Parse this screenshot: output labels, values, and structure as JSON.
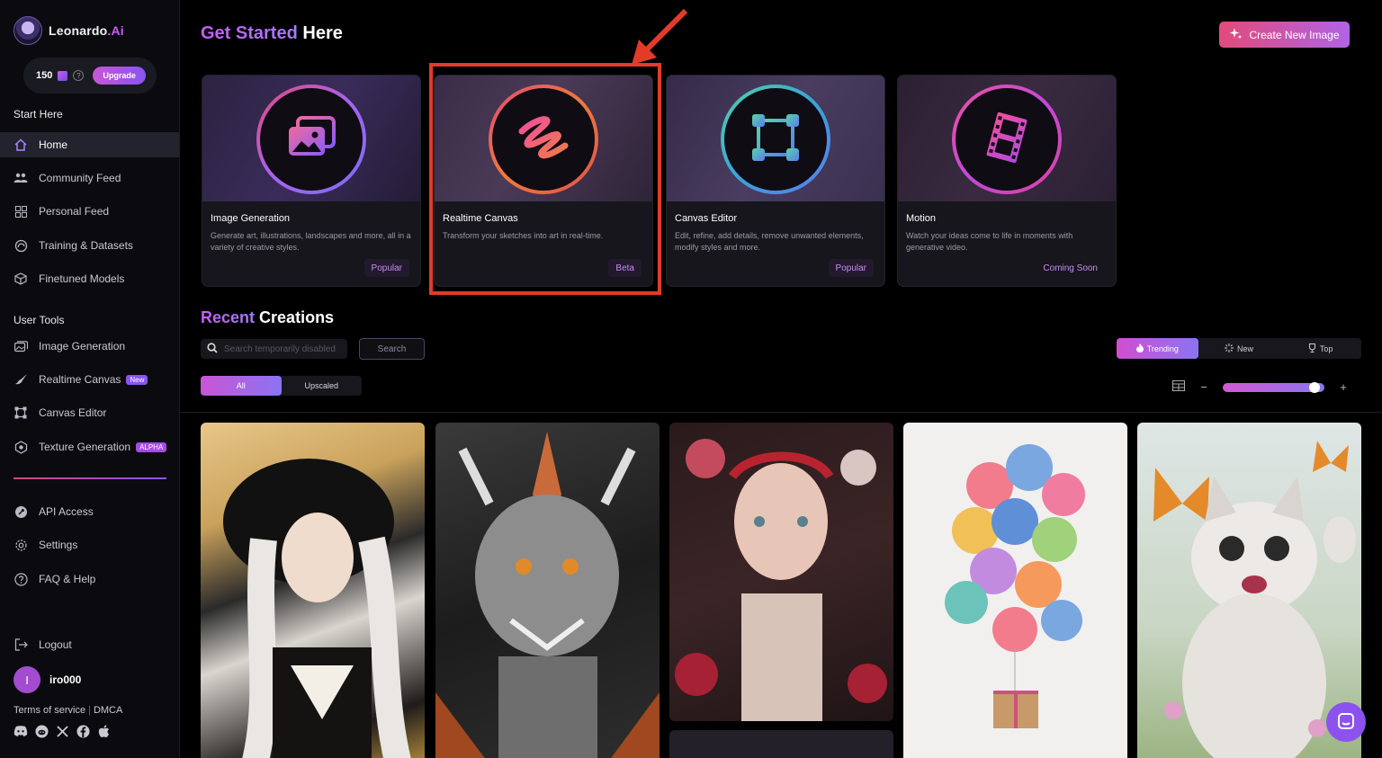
{
  "brand": {
    "name": "Leonardo",
    "suffix": ".Ai"
  },
  "credits": {
    "amount": "150",
    "upgrade_label": "Upgrade"
  },
  "sidebar": {
    "section_start": "Start Here",
    "start_items": [
      {
        "label": "Home",
        "icon": "home-icon"
      },
      {
        "label": "Community Feed",
        "icon": "users-icon"
      },
      {
        "label": "Personal Feed",
        "icon": "grid-icon"
      },
      {
        "label": "Training & Datasets",
        "icon": "training-icon"
      },
      {
        "label": "Finetuned Models",
        "icon": "cube-icon"
      }
    ],
    "section_tools": "User Tools",
    "tool_items": [
      {
        "label": "Image Generation",
        "icon": "image-icon"
      },
      {
        "label": "Realtime Canvas",
        "icon": "brush-icon",
        "badge": "New"
      },
      {
        "label": "Canvas Editor",
        "icon": "canvas-icon"
      },
      {
        "label": "Texture Generation",
        "icon": "texture-icon",
        "badge": "ALPHA"
      }
    ],
    "bottom_items": [
      {
        "label": "API Access",
        "icon": "api-icon"
      },
      {
        "label": "Settings",
        "icon": "gear-icon"
      },
      {
        "label": "FAQ & Help",
        "icon": "help-icon"
      }
    ],
    "logout": "Logout",
    "user": {
      "initial": "I",
      "name": "iro000"
    },
    "legal": {
      "terms": "Terms of service",
      "sep": "|",
      "dmca": "DMCA"
    },
    "socials": [
      "discord-icon",
      "reddit-icon",
      "x-icon",
      "facebook-icon",
      "apple-icon"
    ]
  },
  "header": {
    "title_accent": "Get Started",
    "title_rest": "Here",
    "create_button": "Create New Image"
  },
  "cards": [
    {
      "title": "Image Generation",
      "desc": "Generate art, illustrations, landscapes and more, all in a variety of creative styles.",
      "tag": "Popular",
      "icon": "image-stack-icon"
    },
    {
      "title": "Realtime Canvas",
      "desc": "Transform your sketches into art in real-time.",
      "tag": "Beta",
      "icon": "scribble-icon"
    },
    {
      "title": "Canvas Editor",
      "desc": "Edit, refine, add details, remove unwanted elements, modify styles and more.",
      "tag": "Popular",
      "icon": "canvas-nodes-icon"
    },
    {
      "title": "Motion",
      "desc": "Watch your ideas come to life in moments with generative video.",
      "tag": "Coming Soon",
      "icon": "film-icon"
    }
  ],
  "recent": {
    "title_accent": "Recent",
    "title_rest": "Creations",
    "search_placeholder": "Search temporarily disabled",
    "search_button": "Search",
    "filter_tabs": [
      "All",
      "Upscaled"
    ],
    "sort_tabs": [
      "Trending",
      "New",
      "Top"
    ],
    "zoom_level": 0.95
  },
  "colors": {
    "accent": "#c55ef7",
    "highlight_box": "#e23b28",
    "upgrade_gradient_start": "#c955d6",
    "upgrade_gradient_end": "#8a54f2"
  }
}
